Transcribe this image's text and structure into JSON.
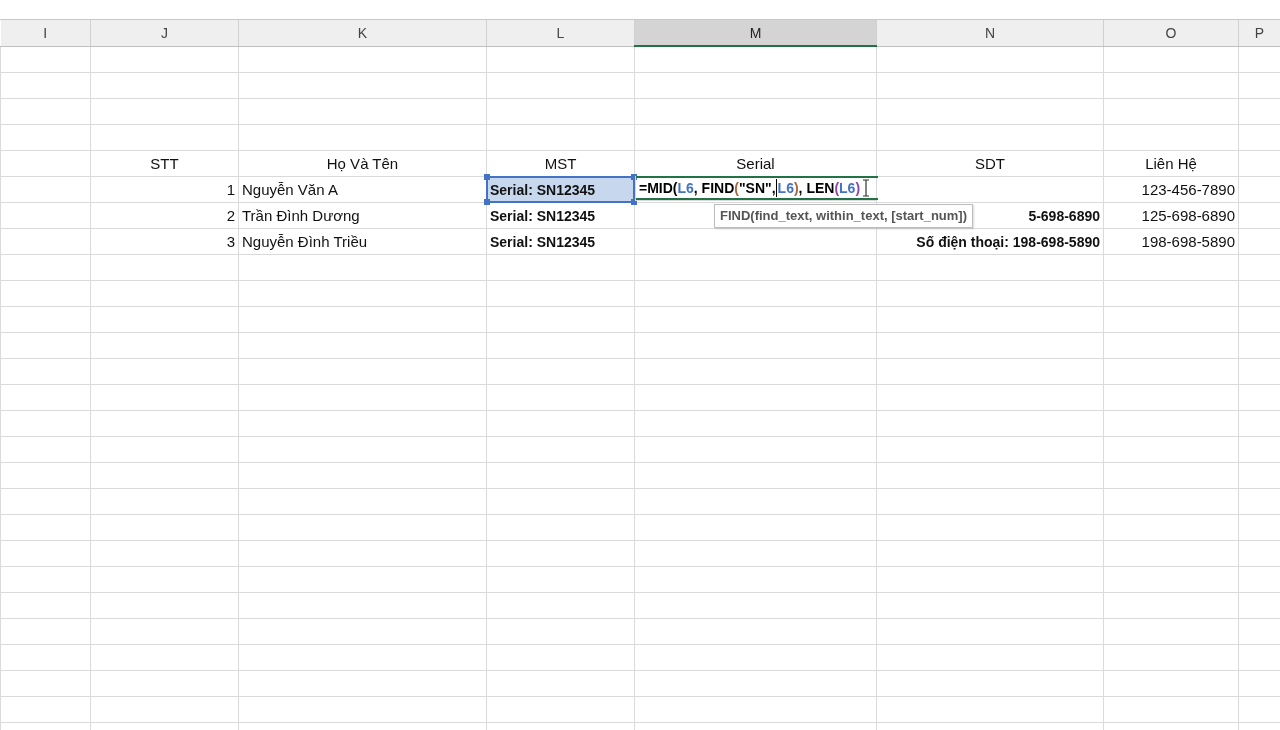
{
  "columns": [
    {
      "label": "I",
      "selected": false
    },
    {
      "label": "J",
      "selected": false
    },
    {
      "label": "K",
      "selected": false
    },
    {
      "label": "L",
      "selected": false
    },
    {
      "label": "M",
      "selected": true
    },
    {
      "label": "N",
      "selected": false
    },
    {
      "label": "O",
      "selected": false
    },
    {
      "label": "P",
      "selected": false
    }
  ],
  "rows": [
    {
      "cells": [
        null,
        {
          "text": "STT",
          "kind": "heading",
          "highlighted": false
        },
        {
          "text": "Họ Và Tên",
          "kind": "heading",
          "highlighted": false
        },
        {
          "text": "MST",
          "kind": "heading",
          "highlighted": false
        },
        {
          "text": "Serial",
          "kind": "heading",
          "highlighted": false
        },
        {
          "text": "SDT",
          "kind": "heading",
          "highlighted": false
        },
        {
          "text": "Liên Hệ",
          "kind": "heading",
          "highlighted": false
        },
        null
      ]
    },
    {
      "cells": [
        null,
        {
          "text": "1",
          "kind": "number",
          "highlighted": false
        },
        {
          "text": "Nguyễn Văn A",
          "kind": "text",
          "highlighted": false
        },
        {
          "text": "Serial: SN12345",
          "kind": "bold",
          "highlighted": true
        },
        {
          "kind": "editor"
        },
        null,
        {
          "text": "123-456-7890",
          "kind": "number",
          "highlighted": false
        },
        null
      ]
    },
    {
      "cells": [
        null,
        {
          "text": "2",
          "kind": "number",
          "highlighted": false
        },
        {
          "text": "Trần Đình Dương",
          "kind": "text",
          "highlighted": false
        },
        {
          "text": "Serial: SN12345",
          "kind": "bold",
          "highlighted": false
        },
        null,
        {
          "text": "5-698-6890",
          "kind": "bold-number",
          "highlighted": false
        },
        {
          "text": "125-698-6890",
          "kind": "number",
          "highlighted": false
        },
        null
      ]
    },
    {
      "cells": [
        null,
        {
          "text": "3",
          "kind": "number",
          "highlighted": false
        },
        {
          "text": "Nguyễn Đình Triều",
          "kind": "text",
          "highlighted": false
        },
        {
          "text": "Serial: SN12345",
          "kind": "bold",
          "highlighted": false
        },
        null,
        {
          "text": "Số điện thoại: 198-698-5890",
          "kind": "bold-number",
          "highlighted": false
        },
        {
          "text": "198-698-5890",
          "kind": "number",
          "highlighted": false
        },
        null
      ]
    }
  ],
  "formula_editor": {
    "parts": [
      {
        "kind": "text",
        "text": "=MID(",
        "color": "#000000"
      },
      {
        "kind": "text",
        "text": "L6",
        "color": "#4472c4"
      },
      {
        "kind": "text",
        "text": ", FIND",
        "color": "#000000"
      },
      {
        "kind": "text",
        "text": "(",
        "color": "#a5673f"
      },
      {
        "kind": "text",
        "text": "\"SN\", ",
        "color": "#000000"
      },
      {
        "kind": "caret"
      },
      {
        "kind": "text",
        "text": "L6",
        "color": "#4472c4"
      },
      {
        "kind": "text",
        "text": ")",
        "color": "#a5673f"
      },
      {
        "kind": "text",
        "text": ", LEN",
        "color": "#000000"
      },
      {
        "kind": "text",
        "text": "(",
        "color": "#8e44ad"
      },
      {
        "kind": "text",
        "text": "L6",
        "color": "#4472c4"
      },
      {
        "kind": "text",
        "text": ")",
        "color": "#8e44ad"
      }
    ],
    "tooltip": "FIND(find_text, **within_text**, [start_num])"
  }
}
